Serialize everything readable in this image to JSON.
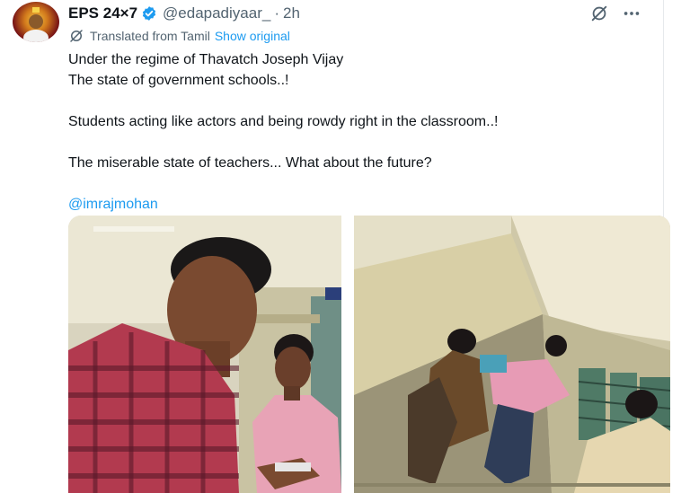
{
  "account": {
    "display_name": "EPS 24×7",
    "handle": "@edapadiyaar_",
    "separator": "·",
    "time": "2h"
  },
  "translation": {
    "label": "Translated from Tamil",
    "show_original": "Show original"
  },
  "tweet": {
    "line1": "Under the regime of Thavatch Joseph Vijay",
    "line2": "The state of government schools..!",
    "line3": "Students acting like actors and being rowdy right in the classroom..!",
    "line4": "The miserable state of teachers... What about the future?",
    "mention": "@imrajmohan"
  },
  "icons": {
    "verified": "verified-badge-icon",
    "grok": "grok-icon",
    "more": "more-options-icon",
    "translate": "translate-icon"
  },
  "colors": {
    "link": "#1d9bf0",
    "secondary_text": "#536471",
    "verified": "#1d9bf0"
  }
}
